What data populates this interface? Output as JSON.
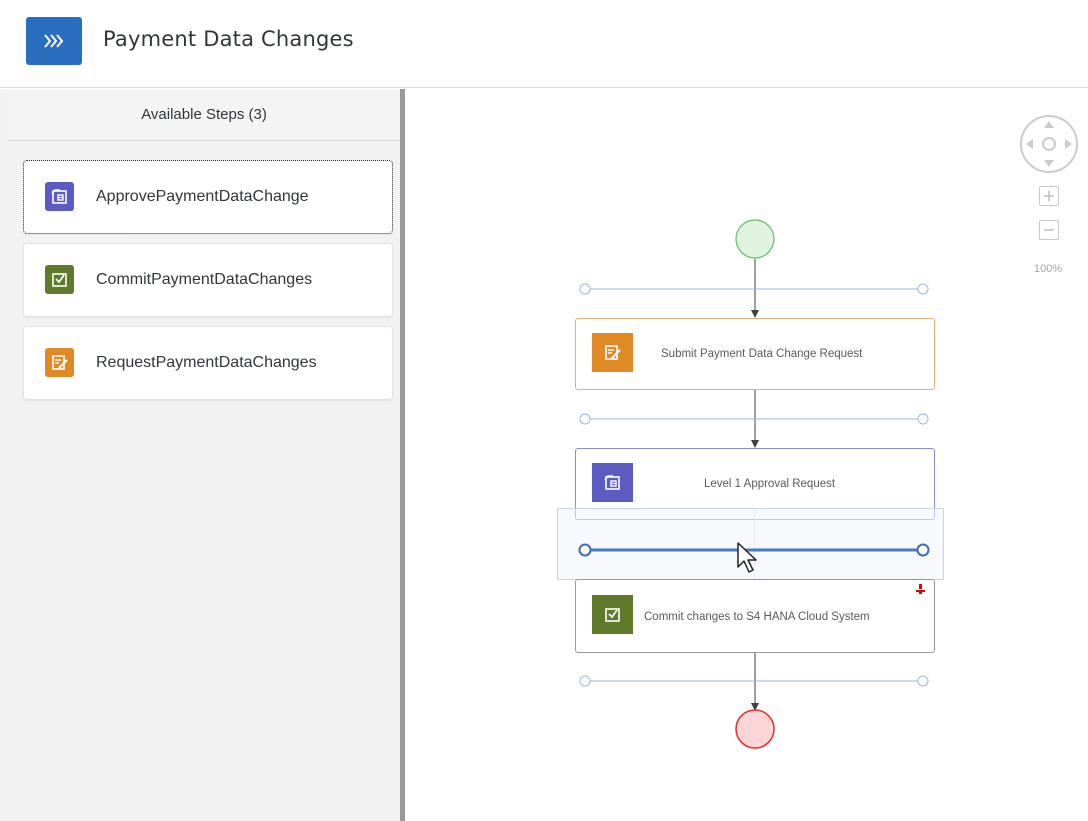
{
  "header": {
    "title": "Payment Data Changes",
    "app_icon": "chevrons-right-icon"
  },
  "sidebar": {
    "title": "Available Steps (3)",
    "steps": [
      {
        "label": "ApprovePaymentDataChange",
        "icon": "approval-task-icon",
        "color": "#5b5bc1"
      },
      {
        "label": "CommitPaymentDataChanges",
        "icon": "checkbox-task-icon",
        "color": "#5f7a2a"
      },
      {
        "label": "RequestPaymentDataChanges",
        "icon": "form-task-icon",
        "color": "#e08a26"
      }
    ]
  },
  "workflow": {
    "tasks": [
      {
        "label": "Submit Payment Data Change Request",
        "icon": "form-task-icon",
        "color": "#e08a26"
      },
      {
        "label": "Level 1 Approval Request",
        "icon": "approval-task-icon",
        "color": "#5b5bc1"
      },
      {
        "label": "Commit changes to S4 HANA Cloud System",
        "icon": "checkbox-task-icon",
        "color": "#5f7a2a"
      }
    ],
    "start_event": "start-event",
    "end_event": "end-event"
  },
  "navigation": {
    "zoom_label": "100%",
    "zoom_in": "+",
    "zoom_out": "−"
  },
  "colors": {
    "accent_blue": "#2a6fbf",
    "connector": "#7a9ccf",
    "start_fill": "#dff3df",
    "end_fill": "#fbd6d6"
  }
}
